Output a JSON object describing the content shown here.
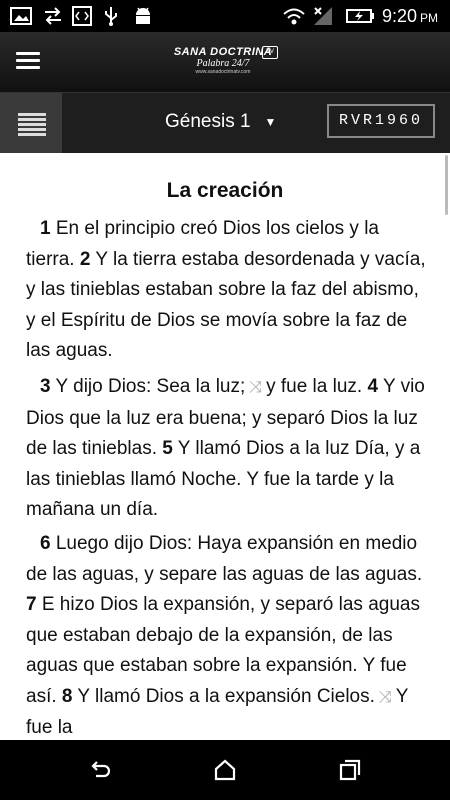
{
  "status_bar": {
    "time": "9:20",
    "ampm": "PM",
    "icons": [
      "image-icon",
      "sync-arrows-icon",
      "code-icon",
      "usb-icon",
      "android-icon",
      "wifi-icon",
      "signal-icon",
      "battery-icon"
    ]
  },
  "app_bar": {
    "logo_line1": "SANA DOCTRINA",
    "logo_line2": "Palabra 24/7",
    "logo_line3": "www.sanadoctrinatv.com",
    "logo_badge": "TV"
  },
  "toolbar": {
    "book_chapter": "Génesis 1",
    "dropdown_caret": "▼",
    "version": "RVR1960"
  },
  "passage": {
    "heading": "La creación",
    "paragraphs": [
      {
        "v1n": "1",
        "v1t": " En el principio creó Dios los cielos y la tierra. ",
        "v2n": "2",
        "v2t": " Y la tierra estaba desordenada y vacía, y las tinieblas estaban sobre la faz del abismo, y el Espíritu de Dios se movía sobre la faz de las aguas."
      },
      {
        "v3n": "3",
        "v3t": " Y dijo Dios: Sea la luz;",
        "v3t2": "y fue la luz. ",
        "v4n": "4",
        "v4t": " Y vio Dios que la luz era buena; y separó Dios la luz de las tinieblas. ",
        "v5n": "5",
        "v5t": " Y llamó Dios a la luz Día, y a las tinieblas llamó Noche. Y fue la tarde y la mañana un día."
      },
      {
        "v6n": "6",
        "v6t": " Luego dijo Dios: Haya expansión en medio de las aguas, y separe las aguas de las aguas. ",
        "v7n": "7",
        "v7t": " E hizo Dios la expansión, y separó las aguas que estaban debajo de la expansión, de las aguas que estaban sobre la expansión. Y fue así. ",
        "v8n": "8",
        "v8t": " Y llamó Dios a la expansión Cielos.",
        "v8t2": "Y fue la"
      }
    ],
    "crossref_glyph": "⤨"
  },
  "nav_bar": {
    "icons": [
      "back-icon",
      "home-icon",
      "recents-icon"
    ]
  }
}
